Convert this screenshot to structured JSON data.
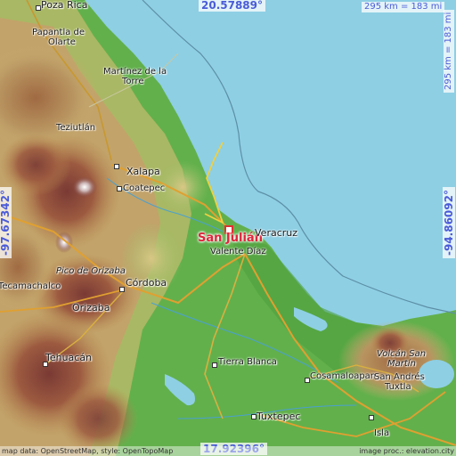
{
  "map": {
    "title": "San Julián",
    "colors": {
      "sea": "#8ecfe4",
      "lowland": "#62b04c",
      "hills": "#c2a36a",
      "mountains": "#8a4a3a",
      "marker": "#e03030",
      "label_marker": "#e0243c",
      "coord_text": "#4a5bd8"
    },
    "coords": {
      "top": "20.57889°",
      "bottom": "17.92396°",
      "left": "-97.67342°",
      "right": "-94.86092°"
    },
    "scale": {
      "top": "295 km = 183 mi",
      "right": "295 km = 183 mi"
    },
    "places": {
      "poza_rica": "Poza Rica",
      "papantla": "Papantla de",
      "papantla2": "Olarte",
      "martinez": "Martínez de la",
      "martinez2": "Torre",
      "teziutlan": "Teziutlán",
      "xalapa": "Xalapa",
      "coatepec": "Coatepec",
      "veracruz": "Veracruz",
      "valente": "Valente Díaz",
      "pico": "Pico de Orizaba",
      "tecamachalco": "Tecamachalco",
      "cordoba": "Córdoba",
      "orizaba": "Orizaba",
      "tehuacan": "Tehuacán",
      "tierra_blanca": "Tierra Blanca",
      "cosamaloapan": "Cosamaloapan",
      "volcan": "Volcán San",
      "volcan2": "Martín",
      "san_andres": "San Andrés",
      "san_andres2": "Tuxtla",
      "tuxtepec": "Tuxtepec",
      "isla": "Isla"
    },
    "attribution": {
      "left": "map data: OpenStreetMap, style: OpenTopoMap",
      "right": "image proc.: elevation.city"
    }
  }
}
